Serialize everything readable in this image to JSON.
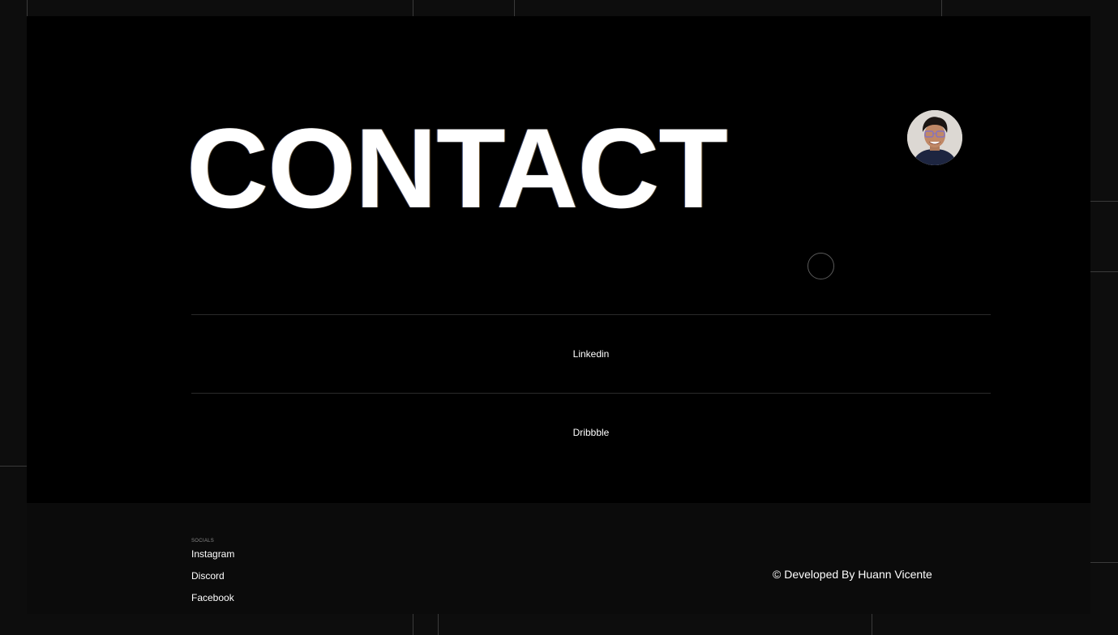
{
  "hero": {
    "title": "CONTACT"
  },
  "links": [
    {
      "label": "Linkedin"
    },
    {
      "label": "Dribbble"
    }
  ],
  "footer": {
    "socials_label": "SOCIALS",
    "socials": [
      {
        "label": "Instagram"
      },
      {
        "label": "Discord"
      },
      {
        "label": "Facebook"
      }
    ],
    "credit": "© Developed By Huann Vicente"
  },
  "colors": {
    "background": "#000000",
    "outer": "#0d0d0d",
    "text": "#ffffff"
  }
}
